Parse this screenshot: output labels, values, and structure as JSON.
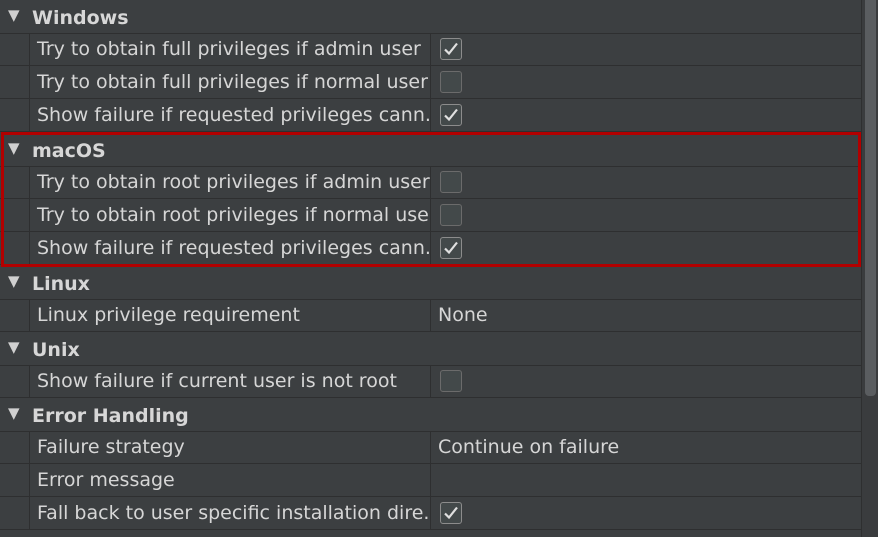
{
  "sections": [
    {
      "title": "Windows",
      "rows": [
        {
          "label": "Try to obtain full privileges if admin user",
          "type": "checkbox",
          "checked": true
        },
        {
          "label": "Try to obtain full privileges if normal user",
          "type": "checkbox",
          "checked": false
        },
        {
          "label": "Show failure if requested privileges cann...",
          "type": "checkbox",
          "checked": true
        }
      ]
    },
    {
      "title": "macOS",
      "rows": [
        {
          "label": "Try to obtain root privileges if admin user",
          "type": "checkbox",
          "checked": false
        },
        {
          "label": "Try to obtain root privileges if normal user",
          "type": "checkbox",
          "checked": false
        },
        {
          "label": "Show failure if requested privileges cann...",
          "type": "checkbox",
          "checked": true
        }
      ]
    },
    {
      "title": "Linux",
      "rows": [
        {
          "label": "Linux privilege requirement",
          "type": "text",
          "value": "None"
        }
      ]
    },
    {
      "title": "Unix",
      "rows": [
        {
          "label": "Show failure if current user is not root",
          "type": "checkbox",
          "checked": false
        }
      ]
    },
    {
      "title": "Error Handling",
      "rows": [
        {
          "label": "Failure strategy",
          "type": "text",
          "value": "Continue on failure"
        },
        {
          "label": "Error message",
          "type": "text",
          "value": ""
        },
        {
          "label": "Fall back to user specific installation dire...",
          "type": "checkbox",
          "checked": true
        }
      ]
    }
  ],
  "colors": {
    "background": "#3c3f41",
    "highlight_border": "#b20000",
    "text": "#d6d6d6"
  },
  "icons": {
    "expand": "triangle-down-icon",
    "check": "checkmark-icon"
  }
}
